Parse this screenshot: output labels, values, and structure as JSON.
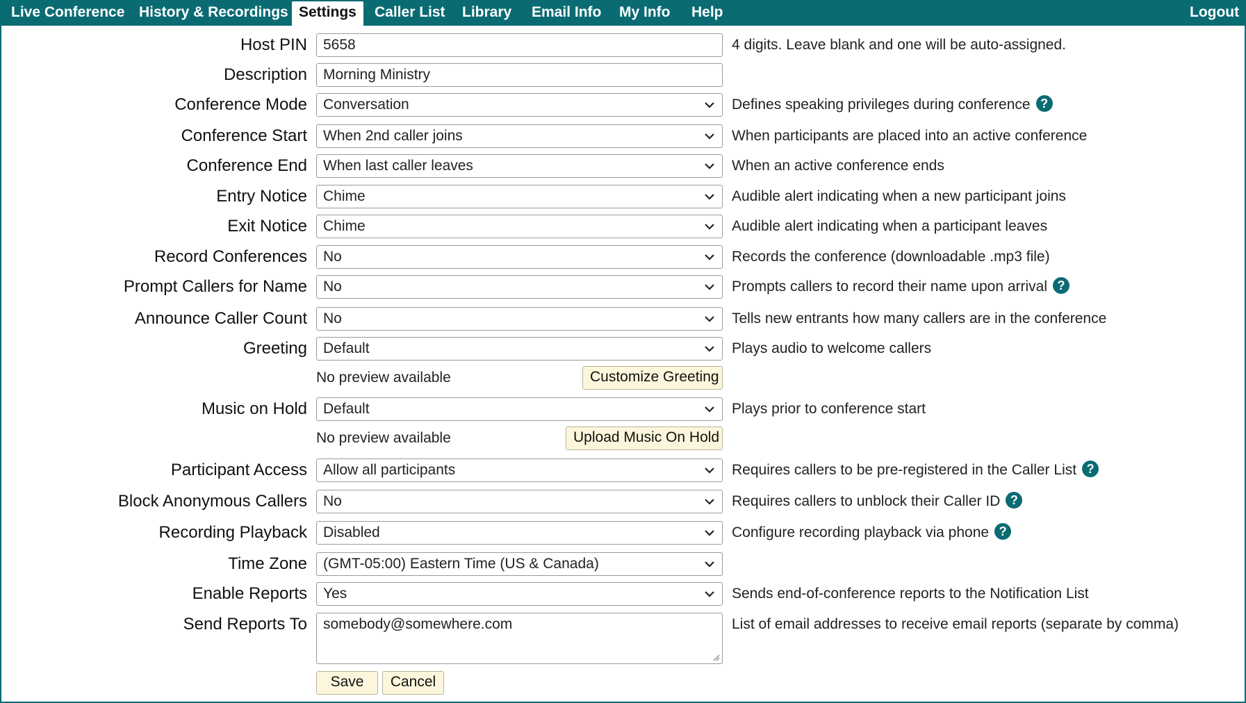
{
  "nav": {
    "tabs": [
      {
        "label": "Live Conference"
      },
      {
        "label": "History & Recordings"
      },
      {
        "label": "Settings"
      },
      {
        "label": "Caller List"
      },
      {
        "label": "Library"
      },
      {
        "label": "Email Info"
      },
      {
        "label": "My Info"
      },
      {
        "label": "Help"
      }
    ],
    "active_tab": "Settings",
    "logout_label": "Logout"
  },
  "form": {
    "host_pin": {
      "label": "Host PIN",
      "value": "5658",
      "help": "4 digits. Leave blank and one will be auto-assigned."
    },
    "description": {
      "label": "Description",
      "value": "Morning Ministry"
    },
    "conference_mode": {
      "label": "Conference Mode",
      "value": "Conversation",
      "help": "Defines speaking privileges during conference"
    },
    "conference_start": {
      "label": "Conference Start",
      "value": "When 2nd caller joins",
      "help": "When participants are placed into an active conference"
    },
    "conference_end": {
      "label": "Conference End",
      "value": "When last caller leaves",
      "help": "When an active conference ends"
    },
    "entry_notice": {
      "label": "Entry Notice",
      "value": "Chime",
      "help": "Audible alert indicating when a new participant joins"
    },
    "exit_notice": {
      "label": "Exit Notice",
      "value": "Chime",
      "help": "Audible alert indicating when a participant leaves"
    },
    "record_conferences": {
      "label": "Record Conferences",
      "value": "No",
      "help": "Records the conference (downloadable .mp3 file)"
    },
    "prompt_callers_for_name": {
      "label": "Prompt Callers for Name",
      "value": "No",
      "help": "Prompts callers to record their name upon arrival"
    },
    "announce_caller_count": {
      "label": "Announce Caller Count",
      "value": "No",
      "help": "Tells new entrants how many callers are in the conference"
    },
    "greeting": {
      "label": "Greeting",
      "value": "Default",
      "help": "Plays audio to welcome callers",
      "preview": "No preview available",
      "button": "Customize Greeting"
    },
    "music_on_hold": {
      "label": "Music on Hold",
      "value": "Default",
      "help": "Plays prior to conference start",
      "preview": "No preview available",
      "button": "Upload Music On Hold"
    },
    "participant_access": {
      "label": "Participant Access",
      "value": "Allow all participants",
      "help": "Requires callers to be pre-registered in the Caller List"
    },
    "block_anonymous_callers": {
      "label": "Block Anonymous Callers",
      "value": "No",
      "help": "Requires callers to unblock their Caller ID"
    },
    "recording_playback": {
      "label": "Recording Playback",
      "value": "Disabled",
      "help": "Configure recording playback via phone"
    },
    "time_zone": {
      "label": "Time Zone",
      "value": "(GMT-05:00) Eastern Time (US & Canada)"
    },
    "enable_reports": {
      "label": "Enable Reports",
      "value": "Yes",
      "help": "Sends end-of-conference reports to the Notification List"
    },
    "send_reports_to": {
      "label": "Send Reports To",
      "value": "somebody@somewhere.com",
      "help": "List of email addresses to receive email reports (separate by comma)"
    }
  },
  "actions": {
    "save_label": "Save",
    "cancel_label": "Cancel"
  },
  "icons": {
    "help": "question-circle-icon",
    "dropdown": "chevron-down-icon",
    "resize": "resize-grip-icon",
    "help_glyph": "?"
  },
  "colors": {
    "nav_bg": "#0a6b73",
    "help_icon": "#0a6b73",
    "button_bg": "#fcf6dc",
    "frame_border": "#0a6b73"
  }
}
